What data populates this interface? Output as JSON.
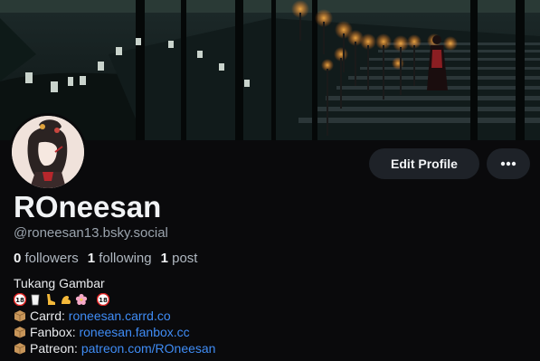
{
  "profile": {
    "display_name": "ROneesan",
    "handle": "@roneesan13.bsky.social",
    "edit_label": "Edit Profile",
    "more_label": "•••",
    "stats": {
      "followers_count": "0",
      "followers_label": "followers",
      "following_count": "1",
      "following_label": "following",
      "posts_count": "1",
      "posts_label": "post"
    }
  },
  "bio": {
    "title": "Tukang Gambar",
    "emoji": [
      "18-plus-icon",
      "milk-glass-icon",
      "leg-icon",
      "flexed-biceps-icon",
      "cherry-blossom-icon",
      "18-plus-icon"
    ],
    "links": [
      {
        "label": "Carrd:",
        "url": "roneesan.carrd.co"
      },
      {
        "label": "Fanbox:",
        "url": "roneesan.fanbox.cc"
      },
      {
        "label": "Patreon:",
        "url": "patreon.com/ROneesan"
      }
    ]
  },
  "colors": {
    "background": "#0a0a0c",
    "button": "#1e2228",
    "link": "#3f8cf5",
    "muted": "#9aa3ad"
  }
}
